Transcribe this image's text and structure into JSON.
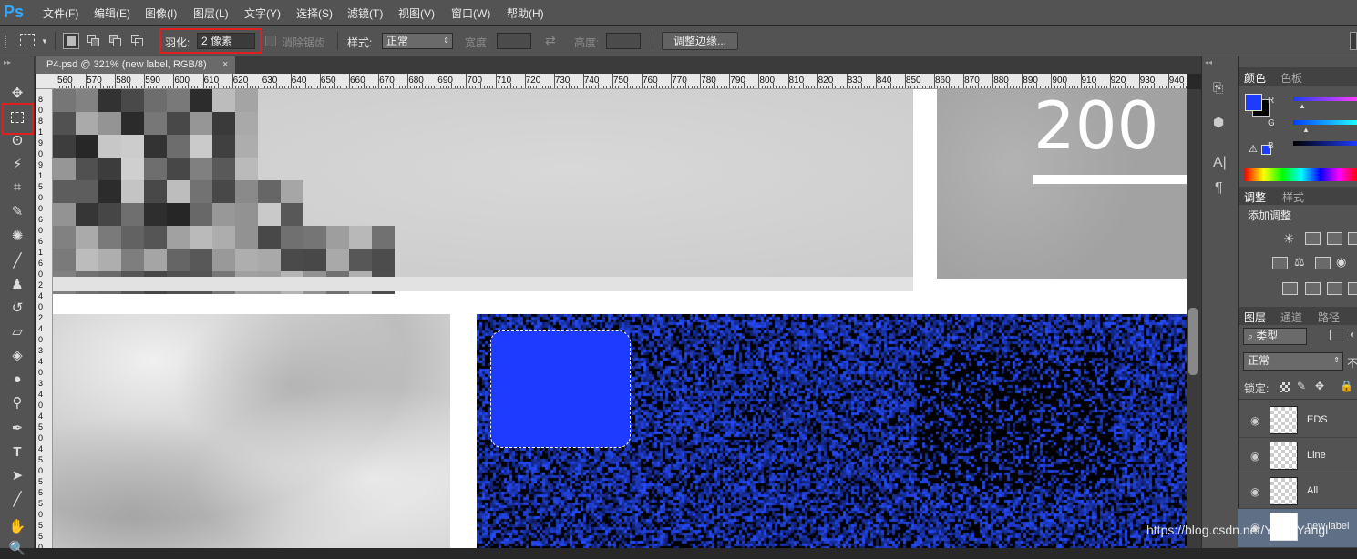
{
  "app": {
    "logo": "Ps"
  },
  "menu": [
    "文件(F)",
    "编辑(E)",
    "图像(I)",
    "图层(L)",
    "文字(Y)",
    "选择(S)",
    "滤镜(T)",
    "视图(V)",
    "窗口(W)",
    "帮助(H)"
  ],
  "options": {
    "feather_label": "羽化:",
    "feather_value": "2 像素",
    "antialias_label": "消除锯齿",
    "style_label": "样式:",
    "style_value": "正常",
    "width_label": "宽度:",
    "height_label": "高度:",
    "refine_edge_button": "调整边缘..."
  },
  "document": {
    "tab_title": "P4.psd @ 321% (new label, RGB/8)",
    "close_glyph": "×",
    "ruler_top_labels": [
      "560",
      "570",
      "580",
      "590",
      "600",
      "610",
      "620",
      "630",
      "640",
      "650",
      "660",
      "670",
      "680",
      "690",
      "700",
      "710",
      "720",
      "730",
      "740",
      "750",
      "760",
      "770",
      "780",
      "790",
      "800",
      "810",
      "820",
      "830",
      "840",
      "850",
      "860",
      "870",
      "880",
      "890",
      "900",
      "910",
      "920",
      "930",
      "940"
    ],
    "ruler_left_labels": [
      "8",
      "0",
      "8",
      "1",
      "9",
      "0",
      "9",
      "1",
      "5",
      "0",
      "0",
      "6",
      "0",
      "6",
      "1",
      "6",
      "0",
      "2",
      "4",
      "0",
      "2",
      "4",
      "0",
      "3",
      "4",
      "0",
      "3",
      "4",
      "0",
      "4",
      "5",
      "0",
      "4",
      "5",
      "0",
      "5",
      "5",
      "5",
      "0",
      "5",
      "5",
      "0"
    ],
    "canvas_text": "200"
  },
  "right_panels": {
    "color_tabs": [
      "颜色",
      "色板"
    ],
    "channels": [
      "R",
      "G",
      "B"
    ],
    "adjust_tabs": [
      "调整",
      "样式"
    ],
    "add_adjustment": "添加调整",
    "layer_tabs": [
      "图层",
      "通道",
      "路径"
    ],
    "filter_kind": "类型",
    "blend_mode": "正常",
    "opacity_short": "不",
    "lock_label": "锁定:",
    "layers": [
      {
        "name": "EDS"
      },
      {
        "name": "Line"
      },
      {
        "name": "All"
      },
      {
        "name": "new label"
      }
    ]
  },
  "watermark": "https://blog.csdn.net/Yang Yangl",
  "colors": {
    "foreground": "#1e3cff",
    "background": "#000000",
    "highlight": "#e02020",
    "ps_blue": "#31a8ff"
  }
}
